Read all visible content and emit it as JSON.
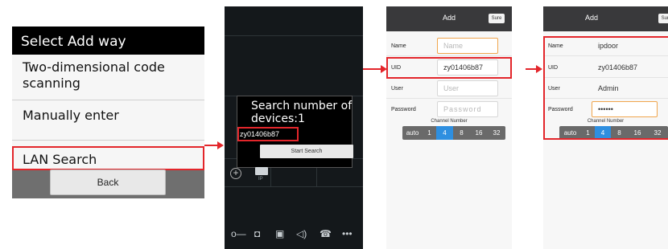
{
  "select_add_way": {
    "title": "Select Add way",
    "options": [
      "Two-dimensional code scanning",
      "Manually enter",
      "LAN Search"
    ],
    "back_label": "Back",
    "highlighted_option": "LAN Search"
  },
  "search_screen": {
    "dialog_title": "Search number of devices:1",
    "found_uid": "zy01406b87",
    "start_button": "Start Search",
    "add_icon": "plus-circle-icon",
    "camera_label": "IP",
    "toolbar_icons": [
      "key-icon",
      "camera-icon",
      "video-icon",
      "speaker-icon",
      "phone-icon",
      "more-icon"
    ],
    "toolbar_glyphs": [
      "o—",
      "◘",
      "▣",
      "◁)",
      "☎",
      "•••"
    ]
  },
  "add_form_empty": {
    "title": "Add",
    "sure_label": "Sure",
    "fields": [
      {
        "label": "Name",
        "value": "",
        "placeholder": "Name"
      },
      {
        "label": "UID",
        "value": "zy01406b87",
        "placeholder": ""
      },
      {
        "label": "User",
        "value": "",
        "placeholder": "User"
      },
      {
        "label": "Password",
        "value": "",
        "placeholder": "Password"
      }
    ],
    "channel_label": "Channel Number",
    "channels": [
      "auto",
      "1",
      "4",
      "8",
      "16",
      "32"
    ],
    "selected_channel": "4"
  },
  "add_form_filled": {
    "title": "Add",
    "sure_label": "Sure",
    "fields": [
      {
        "label": "Name",
        "value": "ipdoor"
      },
      {
        "label": "UID",
        "value": "zy01406b87"
      },
      {
        "label": "User",
        "value": "Admin"
      },
      {
        "label": "Password",
        "value": "••••••"
      }
    ],
    "channel_label": "Channel Number",
    "channels": [
      "auto",
      "1",
      "4",
      "8",
      "16",
      "32"
    ],
    "selected_channel": "4"
  },
  "colors": {
    "highlight_red": "#e3262b",
    "selected_blue": "#2e8fe0",
    "header_dark": "#39393b",
    "focus_orange": "#f0a64d"
  }
}
